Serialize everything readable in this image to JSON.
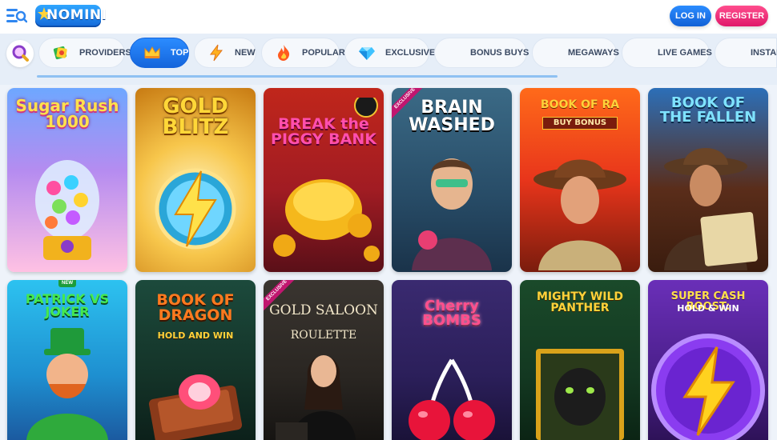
{
  "header": {
    "logo_text": "NOMINI",
    "login_label": "LOG IN",
    "register_label": "REGISTER"
  },
  "nav": {
    "categories": [
      {
        "label": "PROVIDERS",
        "icon": "providers-icon",
        "active": false
      },
      {
        "label": "TOP",
        "icon": "crown-icon",
        "active": true
      },
      {
        "label": "NEW",
        "icon": "lightning-icon",
        "active": false
      },
      {
        "label": "POPULAR",
        "icon": "flame-icon",
        "active": false
      },
      {
        "label": "EXCLUSIVE",
        "icon": "diamond-icon",
        "active": false
      },
      {
        "label": "BONUS BUYS",
        "icon": "",
        "active": false
      },
      {
        "label": "MEGAWAYS",
        "icon": "",
        "active": false
      },
      {
        "label": "LIVE GAMES",
        "icon": "",
        "active": false
      },
      {
        "label": "INSTANT",
        "icon": "",
        "active": false
      }
    ]
  },
  "games": [
    {
      "title": "Sugar Rush 1000",
      "badge": ""
    },
    {
      "title": "GOLD BLITZ",
      "badge": ""
    },
    {
      "title": "BREAK the PIGGY BANK",
      "badge": ""
    },
    {
      "title": "BRAIN WASHED",
      "badge": "EXCLUSIVE"
    },
    {
      "title": "BOOK OF RA",
      "subtitle": "BUY BONUS",
      "badge": ""
    },
    {
      "title": "BOOK OF THE FALLEN",
      "badge": ""
    },
    {
      "title": "PATRICK VS JOKER",
      "badge": "NEW"
    },
    {
      "title": "BOOK OF DRAGON",
      "subtitle": "HOLD AND WIN",
      "badge": ""
    },
    {
      "title": "GOLD SALOON",
      "subtitle": "ROULETTE",
      "badge": "EXCLUSIVE"
    },
    {
      "title": "Cherry BOMBS",
      "badge": ""
    },
    {
      "title": "MIGHTY WILD PANTHER",
      "badge": ""
    },
    {
      "title": "SUPER CASH BOOST:",
      "subtitle": "HOLD & WIN",
      "badge": ""
    }
  ],
  "colors": {
    "brand_blue": "#1565dc",
    "register_pink": "#e0186a",
    "page_bg": "#eef3fa"
  }
}
